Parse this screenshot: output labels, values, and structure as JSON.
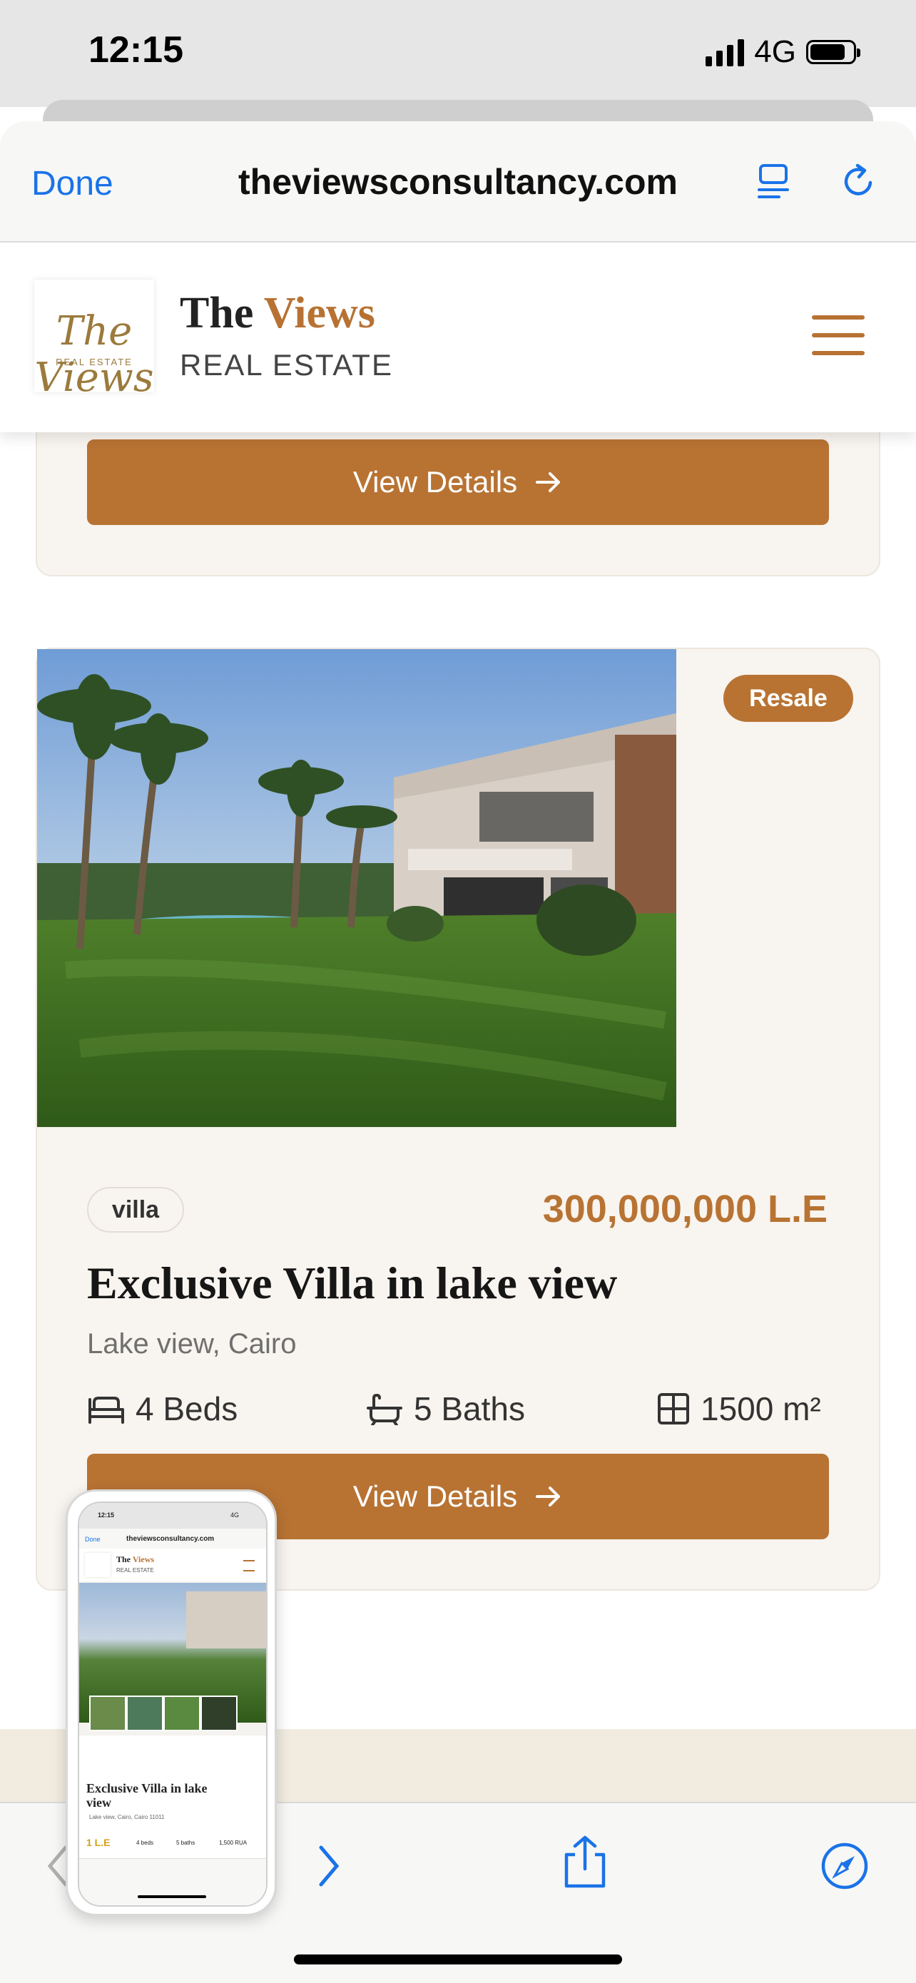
{
  "status_bar": {
    "time": "12:15",
    "network": "4G",
    "battery_level": 0.8
  },
  "browser": {
    "done_label": "Done",
    "url": "theviewsconsultancy.com"
  },
  "site": {
    "logo_script": "The Views",
    "logo_sub": "REAL ESTATE",
    "brand_word1": "The",
    "brand_word2": "Views",
    "brand_sub": "REAL ESTATE",
    "accent_color": "#b87333"
  },
  "previous_card": {
    "button_label": "View Details"
  },
  "listing": {
    "badge": "Resale",
    "type": "villa",
    "price": "300,000,000 L.E",
    "title": "Exclusive Villa in lake view",
    "location": "Lake view, Cairo",
    "beds": "4 Beds",
    "baths": "5 Baths",
    "area": "1500 m²",
    "button_label": "View Details"
  },
  "thumbnail": {
    "time": "12:15",
    "network": "4G",
    "done": "Done",
    "url": "theviewsconsultancy.com",
    "brand_word1": "The",
    "brand_word2": "Views",
    "brand_sub": "REAL ESTATE",
    "title": "Exclusive Villa in lake view",
    "location": "Lake view, Cairo, Cairo 11011",
    "price": "1 L.E",
    "beds": "4 beds",
    "baths": "5 baths",
    "area": "1,500 RUA"
  },
  "icons": [
    "reader-icon",
    "reload-icon",
    "menu-icon",
    "arrow-right-icon",
    "bed-icon",
    "bath-icon",
    "area-icon",
    "back-icon",
    "forward-icon",
    "share-icon",
    "compass-icon"
  ]
}
